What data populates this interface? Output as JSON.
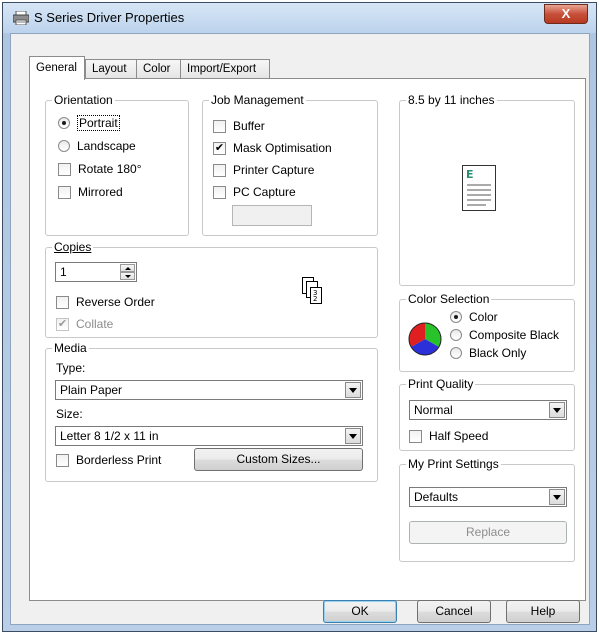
{
  "window": {
    "title": "S Series Driver Properties",
    "close_glyph": "X"
  },
  "tabs": [
    {
      "label": "General",
      "active": true
    },
    {
      "label": "Layout",
      "active": false
    },
    {
      "label": "Color",
      "active": false
    },
    {
      "label": "Import/Export",
      "active": false
    }
  ],
  "orientation": {
    "legend": "Orientation",
    "portrait": "Portrait",
    "landscape": "Landscape",
    "rotate": "Rotate 180°",
    "mirrored": "Mirrored"
  },
  "job_management": {
    "legend": "Job Management",
    "buffer": "Buffer",
    "mask": "Mask Optimisation",
    "printer_capture": "Printer Capture",
    "pc_capture": "PC Capture",
    "pc_capture_value": ""
  },
  "paper_preview": {
    "legend": "8.5 by 11 inches",
    "page_letter": "E"
  },
  "copies": {
    "legend": "Copies",
    "value": "1",
    "reverse_order": "Reverse Order",
    "collate": "Collate",
    "collate_pages": [
      "3",
      "2"
    ]
  },
  "color_selection": {
    "legend": "Color Selection",
    "color": "Color",
    "composite_black": "Composite Black",
    "black_only": "Black Only"
  },
  "media": {
    "legend": "Media",
    "type_label": "Type:",
    "type_value": "Plain Paper",
    "size_label": "Size:",
    "size_value": "Letter 8 1/2 x 11 in",
    "borderless": "Borderless Print",
    "custom_sizes": "Custom Sizes..."
  },
  "print_quality": {
    "legend": "Print Quality",
    "value": "Normal",
    "half_speed": "Half Speed"
  },
  "my_print_settings": {
    "legend": "My Print Settings",
    "value": "Defaults",
    "replace": "Replace"
  },
  "footer": {
    "ok": "OK",
    "cancel": "Cancel",
    "help": "Help"
  },
  "colors": {
    "accent_default_button": "#3c7fb1",
    "titlebar": "#bcd3ec",
    "close_button": "#c7503a"
  }
}
